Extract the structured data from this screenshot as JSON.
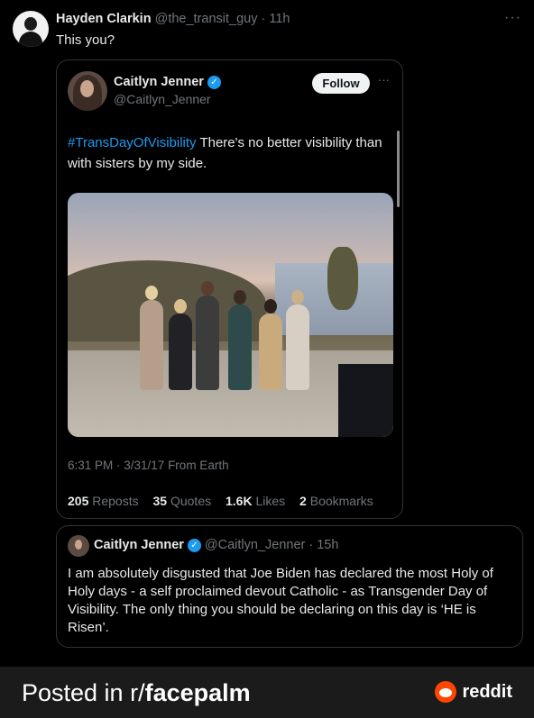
{
  "outer_tweet": {
    "author_name": "Hayden Clarkin",
    "author_meta": "@the_transit_guy · 11h",
    "text": "This you?",
    "more_icon": "···"
  },
  "quoted_tweet": {
    "author_name": "Caitlyn Jenner",
    "author_handle": "@Caitlyn_Jenner",
    "follow_label": "Follow",
    "more_icon": "···",
    "hashtag": "#TransDayOfVisibility",
    "text_rest": " There's no better visibility than with sisters by my side.",
    "timestamp": "6:31 PM · 3/31/17 From Earth",
    "stats": {
      "reposts_count": "205",
      "reposts_label": "Reposts",
      "quotes_count": "35",
      "quotes_label": "Quotes",
      "likes_count": "1.6K",
      "likes_label": "Likes",
      "bookmarks_count": "2",
      "bookmarks_label": "Bookmarks"
    }
  },
  "original_tweet": {
    "author_name": "Caitlyn Jenner",
    "author_meta": "@Caitlyn_Jenner · 15h",
    "text": "I am absolutely disgusted that Joe Biden has declared the most Holy of Holy days - a self proclaimed devout Catholic - as Transgender Day of Visibility. The only thing you should be declaring on this day is ‘HE is Risen’."
  },
  "footer": {
    "posted_prefix": "Posted in r/",
    "subreddit": "facepalm",
    "brand": "reddit"
  },
  "colors": {
    "background": "#000000",
    "accent": "#1d9bf0",
    "muted": "#71767b",
    "reddit_orange": "#ff4500"
  }
}
